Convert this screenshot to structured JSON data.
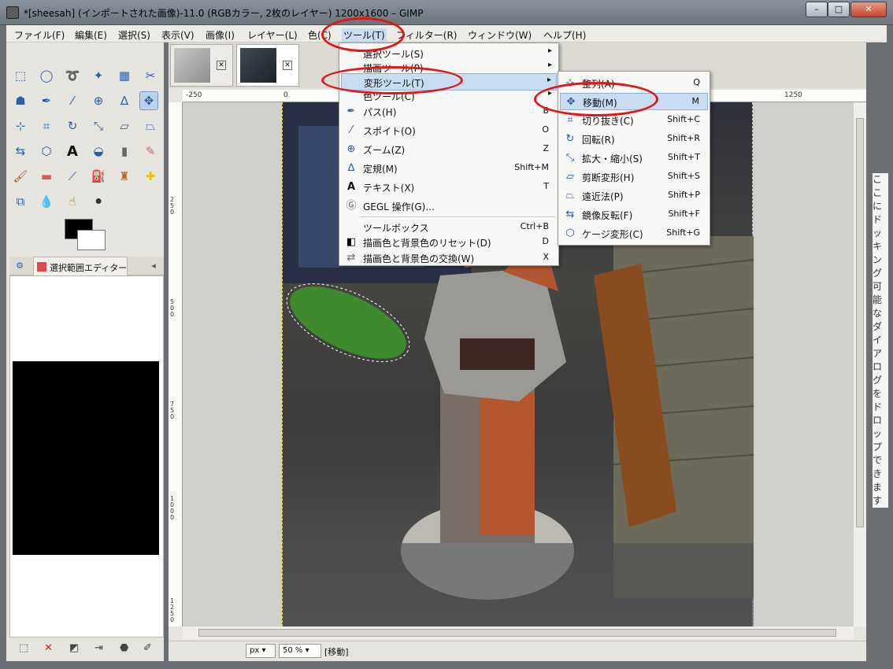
{
  "window": {
    "title": "*[sheesah] (インポートされた画像)-11.0 (RGBカラー, 2枚のレイヤー) 1200x1600 – GIMP",
    "min": "–",
    "max": "□",
    "close": "✕"
  },
  "menubar": [
    "ファイル(F)",
    "編集(E)",
    "選択(S)",
    "表示(V)",
    "画像(I)",
    "レイヤー(L)",
    "色(C)",
    "ツール(T)",
    "フィルター(R)",
    "ウィンドウ(W)",
    "ヘルプ(H)"
  ],
  "tools_menu": {
    "items": [
      {
        "label": "選択ツール(S)",
        "submenu": true
      },
      {
        "label": "描画ツール(P)",
        "submenu": true
      },
      {
        "label": "変形ツール(T)",
        "submenu": true,
        "highlighted": true
      },
      {
        "label": "色ツール(C)",
        "submenu": true
      },
      {
        "label": "パス(H)",
        "shortcut": "B",
        "icon": "path-icon"
      },
      {
        "label": "スポイト(O)",
        "shortcut": "O",
        "icon": "eyedropper-icon"
      },
      {
        "label": "ズーム(Z)",
        "shortcut": "Z",
        "icon": "zoom-icon"
      },
      {
        "label": "定規(M)",
        "shortcut": "Shift+M",
        "icon": "measure-icon"
      },
      {
        "label": "テキスト(X)",
        "shortcut": "T",
        "icon": "text-icon"
      },
      {
        "label": "GEGL 操作(G)...",
        "icon": "gegl-icon"
      },
      {
        "label": "ツールボックス",
        "shortcut": "Ctrl+B"
      },
      {
        "label": "描画色と背景色のリセット(D)",
        "shortcut": "D",
        "icon": "reset-colors-icon"
      },
      {
        "label": "描画色と背景色の交換(W)",
        "shortcut": "X",
        "icon": "swap-colors-icon"
      }
    ]
  },
  "transform_submenu": {
    "items": [
      {
        "label": "整列(A)",
        "shortcut": "Q",
        "icon": "align-icon"
      },
      {
        "label": "移動(M)",
        "shortcut": "M",
        "icon": "move-icon",
        "highlighted": true
      },
      {
        "label": "切り抜き(C)",
        "shortcut": "Shift+C",
        "icon": "crop-icon"
      },
      {
        "label": "回転(R)",
        "shortcut": "Shift+R",
        "icon": "rotate-icon"
      },
      {
        "label": "拡大・縮小(S)",
        "shortcut": "Shift+T",
        "icon": "scale-icon"
      },
      {
        "label": "剪断変形(H)",
        "shortcut": "Shift+S",
        "icon": "shear-icon"
      },
      {
        "label": "遠近法(P)",
        "shortcut": "Shift+P",
        "icon": "perspective-icon"
      },
      {
        "label": "鏡像反転(F)",
        "shortcut": "Shift+F",
        "icon": "flip-icon"
      },
      {
        "label": "ケージ変形(C)",
        "shortcut": "Shift+G",
        "icon": "cage-icon"
      }
    ]
  },
  "dock": {
    "tab_label": "選択範囲エディター"
  },
  "ruler": {
    "top_labels": [
      "-250",
      "0",
      "1250"
    ],
    "left_labels": [
      "250",
      "500",
      "750",
      "1000",
      "1250"
    ]
  },
  "status": {
    "unit": "px",
    "zoom": "50 %",
    "message": "[移動]"
  },
  "side_hint": "ここにドッキング可能なダイアログをドロップできます",
  "colors": {
    "accent": "#c9dcf1",
    "annotation": "#e01818",
    "selection": "#e2d54a"
  }
}
